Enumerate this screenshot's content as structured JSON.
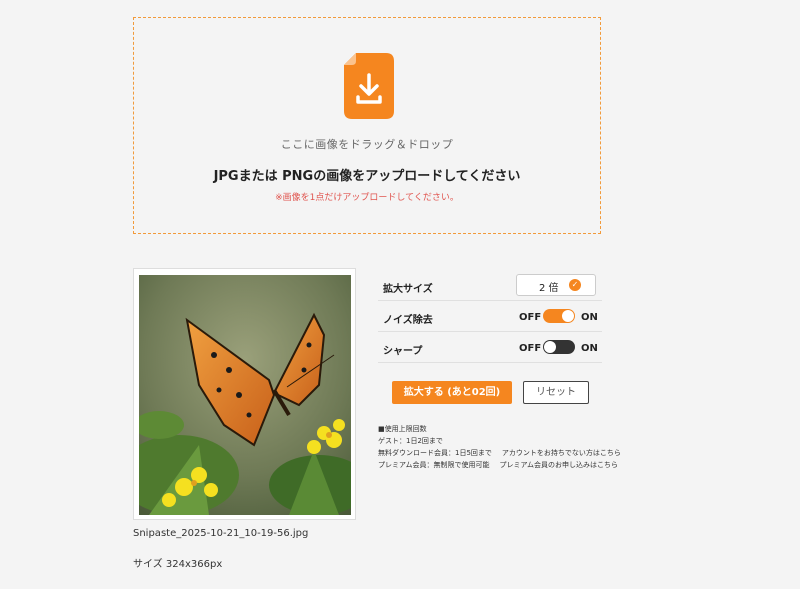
{
  "dropzone": {
    "hint": "ここに画像をドラッグ＆ドロップ",
    "title": "JPGまたは PNGの画像をアップロードしてください",
    "note": "※画像を1点だけアップロードしてください。",
    "icon": "file-download-icon",
    "accent": "#f5861f"
  },
  "preview": {
    "file_name": "Snipaste_2025-10-21_10-19-56.jpg",
    "size_text": "サイズ 324x366px",
    "image": "butterfly-photo"
  },
  "settings": {
    "scale": {
      "label": "拡大サイズ",
      "value": "2 倍"
    },
    "noise": {
      "label": "ノイズ除去",
      "off": "OFF",
      "on": "ON",
      "enabled": true
    },
    "sharp": {
      "label": "シャープ",
      "off": "OFF",
      "on": "ON",
      "enabled": false
    }
  },
  "actions": {
    "enlarge": "拡大する (あと02回)",
    "reset": "リセット"
  },
  "usage": {
    "heading": "■使用上限回数",
    "guest": "ゲスト：1日2回まで",
    "free": "無料ダウンロード会員：1日5回まで",
    "free_link": "アカウントをお持ちでない方はこちら",
    "premium": "プレミアム会員：無制限で使用可能",
    "premium_link": "プレミアム会員のお申し込みはこちら"
  },
  "colors": {
    "accent": "#f5861f",
    "toggle_off": "#333333",
    "note": "#e0554f"
  }
}
